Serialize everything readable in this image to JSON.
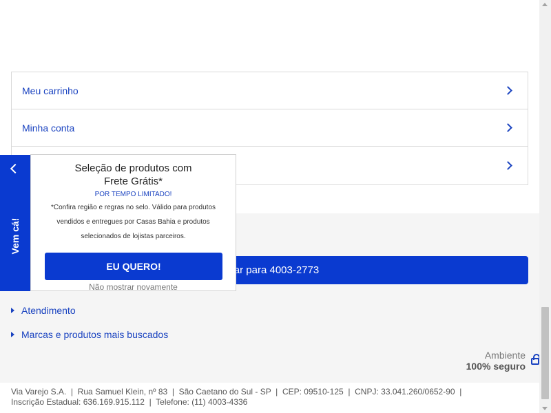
{
  "nav": {
    "items": [
      {
        "label": "Meu carrinho"
      },
      {
        "label": "Minha conta"
      },
      {
        "label": ""
      }
    ]
  },
  "footer": {
    "call_button": "Ligar para 4003-2773",
    "links": [
      {
        "label": "Atendimento"
      },
      {
        "label": "Marcas e produtos mais buscados"
      }
    ],
    "secure": {
      "line1": "Ambiente",
      "line2": "100% seguro"
    },
    "legal_line1": "Via Varejo S.A.  |  Rua Samuel Klein, nº 83  |  São Caetano do Sul - SP  |  CEP: 09510-125  |  CNPJ: 33.041.260/0652-90  |",
    "legal_line2": "Inscrição Estadual: 636.169.915.112  |  Telefone: (11) 4003-4336"
  },
  "side_tab": {
    "label": "Vem cá!"
  },
  "promo": {
    "title_line1": "Seleção de produtos com",
    "title_line2": "Frete Grátis*",
    "limited": "POR TEMPO LIMITADO!",
    "desc_line1": "*Confira região e regras no selo. Válido para produtos",
    "desc_line2": "vendidos e entregues por Casas Bahia e produtos",
    "desc_line3": "selecionados de lojistas parceiros.",
    "cta": "EU QUERO!",
    "dismiss": "Não mostrar novamente"
  },
  "colors": {
    "accent": "#0a3ad0",
    "link": "#1a43c0",
    "footer_bg": "#f5f5f5"
  },
  "icons": [
    "chevron-right-icon",
    "chevron-left-icon",
    "lock-icon",
    "triangle-right-icon"
  ]
}
